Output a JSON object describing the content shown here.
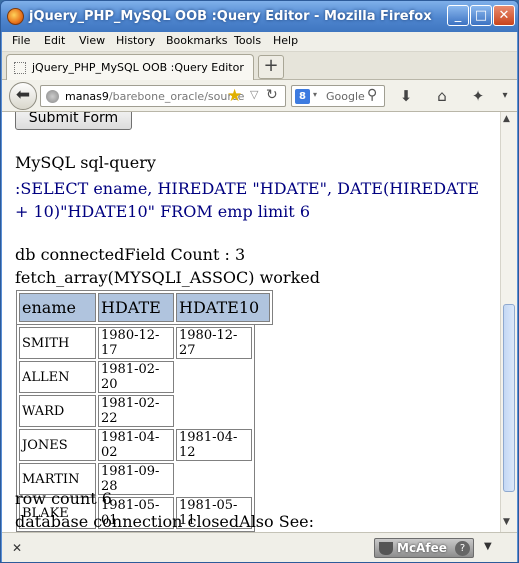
{
  "window": {
    "title": "jQuery_PHP_MySQL OOB :Query Editor - Mozilla Firefox",
    "controls": {
      "minimize": "_",
      "maximize": "□",
      "close": "✕"
    }
  },
  "menu": [
    "File",
    "Edit",
    "View",
    "History",
    "Bookmarks",
    "Tools",
    "Help"
  ],
  "tab": {
    "label": "jQuery_PHP_MySQL OOB :Query Editor",
    "new_tab": "+"
  },
  "nav": {
    "url_host": "manas9",
    "url_path": "/barebone_oracle/source",
    "search_engine_letter": "8",
    "search_placeholder": "Google"
  },
  "page": {
    "submit_label": "Submit Form",
    "heading": "MySQL sql-query",
    "query": ":SELECT ename, HIREDATE \"HDATE\", DATE(HIREDATE + 10)\"HDATE10\" FROM emp limit 6",
    "connect_line": "db connectedField Count : 3",
    "fetch_line": "fetch_array(MYSQLI_ASSOC) worked",
    "table": {
      "headers": [
        "ename",
        "HDATE",
        "HDATE10"
      ],
      "rows": [
        [
          "SMITH",
          "1980-12-17",
          "1980-12-27"
        ],
        [
          "ALLEN",
          "1981-02-20",
          ""
        ],
        [
          "WARD",
          "1981-02-22",
          ""
        ],
        [
          "JONES",
          "1981-04-02",
          "1981-04-12"
        ],
        [
          "MARTIN",
          "1981-09-28",
          ""
        ],
        [
          "BLAKE",
          "1981-05-01",
          "1981-05-11"
        ]
      ]
    },
    "row_count": "row count 6",
    "closed_line": "database connection closedAlso See:"
  },
  "addon_bar": {
    "close": "✕",
    "mcafee_label": "McAfee",
    "help": "?"
  }
}
